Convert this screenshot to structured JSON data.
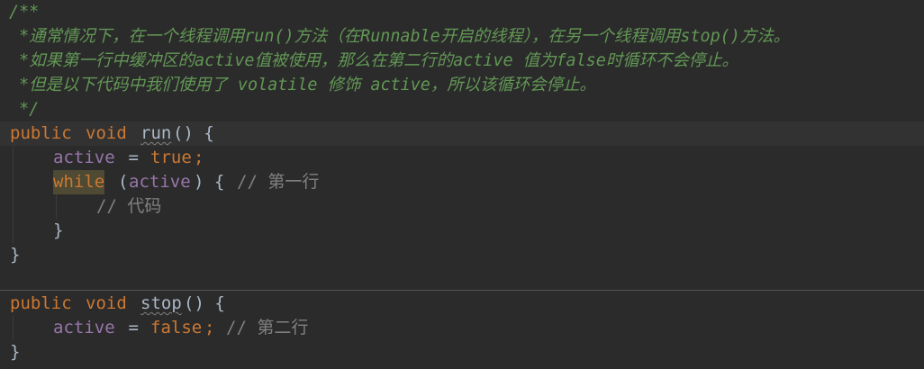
{
  "editor": {
    "lines": [
      {
        "text": "/**"
      },
      {
        "text": " *通常情况下，在一个线程调用run()方法（在Runnable开启的线程），在另一个线程调用stop()方法。"
      },
      {
        "text": " *如果第一行中缓冲区的active值被使用，那么在第二行的active 值为false时循环不会停止。"
      },
      {
        "text": " *但是以下代码中我们使用了 volatile 修饰 active，所以该循环会停止。"
      },
      {
        "text": " */"
      },
      {
        "kw1": "public",
        "kw2": "void",
        "method": "run",
        "rest": "() {"
      },
      {
        "field": "active",
        "op": " = ",
        "value": "true",
        "semi": ";"
      },
      {
        "kw": "while",
        "open": "(",
        "field": "active",
        "close": ") { ",
        "comment": "// 第一行"
      },
      {
        "comment": "// 代码"
      },
      {
        "text": "}"
      },
      {
        "text": "}"
      },
      {
        "text": ""
      },
      {
        "kw1": "public",
        "kw2": "void",
        "method": "stop",
        "rest": "() {"
      },
      {
        "field": "active",
        "op": " = ",
        "value": "false",
        "semi": "; ",
        "comment": "// 第二行"
      },
      {
        "text": "}"
      }
    ]
  }
}
